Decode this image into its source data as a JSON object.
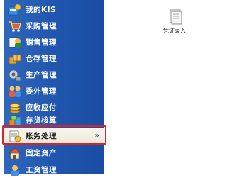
{
  "sidebar": {
    "items": [
      {
        "label": "我的KIS",
        "icon": "my-kis-icon",
        "active": false
      },
      {
        "label": "采购管理",
        "icon": "purchase-management-icon",
        "active": false
      },
      {
        "label": "销售管理",
        "icon": "sales-management-icon",
        "active": false
      },
      {
        "label": "仓存管理",
        "icon": "warehouse-management-icon",
        "active": false
      },
      {
        "label": "生产管理",
        "icon": "production-management-icon",
        "active": false
      },
      {
        "label": "委外管理",
        "icon": "outsourcing-management-icon",
        "active": false
      },
      {
        "label": "应收应付",
        "icon": "receivable-payable-icon",
        "active": false
      },
      {
        "label": "存货核算",
        "icon": "inventory-accounting-icon",
        "active": false
      },
      {
        "label": "账务处理",
        "icon": "accounting-processing-icon",
        "active": true,
        "expand_glyph": "»"
      },
      {
        "label": "固定资产",
        "icon": "fixed-assets-icon",
        "active": false
      },
      {
        "label": "工资管理",
        "icon": "payroll-management-icon",
        "active": false
      }
    ]
  },
  "desktop": {
    "shortcut_label": "凭证录入"
  },
  "colors": {
    "sidebar_blue": "#1f55ad",
    "highlight_red": "#d8232a",
    "active_bg": "#f1eee3"
  }
}
